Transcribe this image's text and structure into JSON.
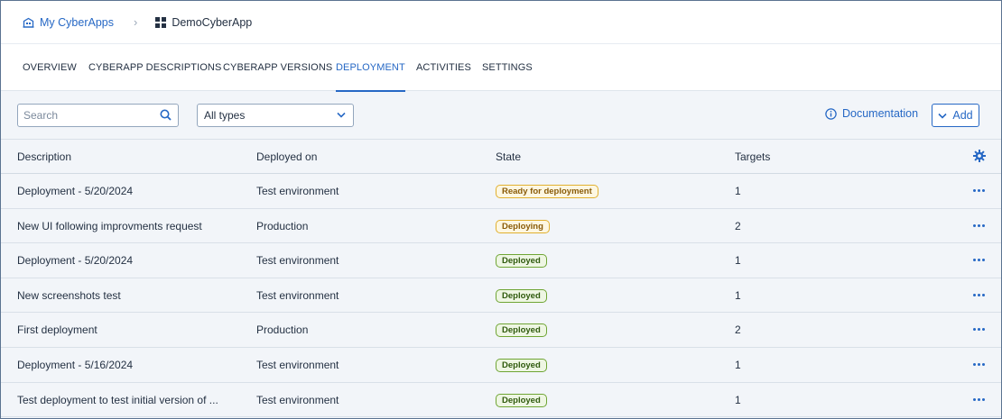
{
  "breadcrumb": {
    "root_label": "My CyberApps",
    "root_icon": "building-icon",
    "separator": "›",
    "current_label": "DemoCyberApp",
    "current_icon": "grid-icon"
  },
  "tabs": [
    {
      "label": "OVERVIEW",
      "active": false
    },
    {
      "label": "CYBERAPP DESCRIPTIONS",
      "active": false
    },
    {
      "label": "CYBERAPP VERSIONS",
      "active": false
    },
    {
      "label": "DEPLOYMENT",
      "active": true
    },
    {
      "label": "ACTIVITIES",
      "active": false
    },
    {
      "label": "SETTINGS",
      "active": false
    }
  ],
  "toolbar": {
    "search_placeholder": "Search",
    "type_filter_value": "All types",
    "documentation_label": "Documentation",
    "add_label": "Add"
  },
  "table": {
    "columns": [
      "Description",
      "Deployed on",
      "State",
      "Targets"
    ],
    "rows": [
      {
        "description": "Deployment - 5/20/2024",
        "deployed_on": "Test environment",
        "state": "Ready for deployment",
        "state_kind": "ready",
        "targets": "1"
      },
      {
        "description": "New UI following improvments request",
        "deployed_on": "Production",
        "state": "Deploying",
        "state_kind": "deploying",
        "targets": "2"
      },
      {
        "description": "Deployment - 5/20/2024",
        "deployed_on": "Test environment",
        "state": "Deployed",
        "state_kind": "deployed",
        "targets": "1"
      },
      {
        "description": "New screenshots test",
        "deployed_on": "Test environment",
        "state": "Deployed",
        "state_kind": "deployed",
        "targets": "1"
      },
      {
        "description": "First deployment",
        "deployed_on": "Production",
        "state": "Deployed",
        "state_kind": "deployed",
        "targets": "2"
      },
      {
        "description": "Deployment - 5/16/2024",
        "deployed_on": "Test environment",
        "state": "Deployed",
        "state_kind": "deployed",
        "targets": "1"
      },
      {
        "description": "Test deployment to test initial version of ...",
        "deployed_on": "Test environment",
        "state": "Deployed",
        "state_kind": "deployed",
        "targets": "1"
      }
    ]
  },
  "colors": {
    "accent": "#2668c5",
    "warning_border": "#e1b02f",
    "success_border": "#6fa534",
    "row_background": "#f2f5f9"
  }
}
